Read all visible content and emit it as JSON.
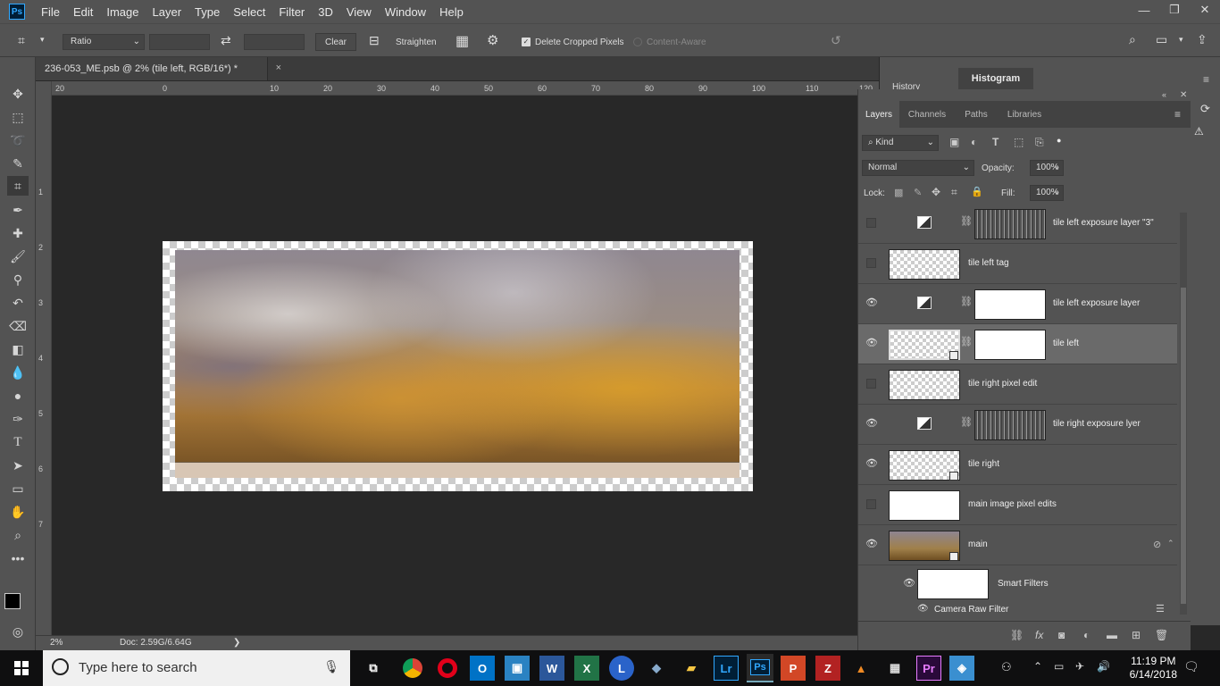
{
  "app": {
    "logo": "Ps",
    "menu": [
      "File",
      "Edit",
      "Image",
      "Layer",
      "Type",
      "Select",
      "Filter",
      "3D",
      "View",
      "Window",
      "Help"
    ]
  },
  "window_controls": {
    "minimize": "—",
    "restore": "❐",
    "close": "✕"
  },
  "options_bar": {
    "ratio": "Ratio",
    "clear": "Clear",
    "straighten": "Straighten",
    "delete_cropped": "Delete Cropped Pixels",
    "content_aware": "Content-Aware"
  },
  "document": {
    "tab_title": "236-053_ME.psb @ 2% (tile left, RGB/16*) *",
    "close": "×"
  },
  "ruler": {
    "h_ticks": [
      "20",
      "0",
      "10",
      "20",
      "30",
      "40",
      "50",
      "60",
      "70",
      "80",
      "90",
      "100",
      "110",
      "120"
    ],
    "v_ticks": [
      "1",
      "2",
      "3",
      "4",
      "5",
      "6",
      "7"
    ]
  },
  "status": {
    "zoom": "2%",
    "doc": "Doc: 2.59G/6.64G",
    "arrow": "❯"
  },
  "collapsed_panels": {
    "history": "History",
    "histogram": "Histogram"
  },
  "layers_panel": {
    "tabs": [
      "Layers",
      "Channels",
      "Paths",
      "Libraries"
    ],
    "filter_kind": "Kind",
    "blend_mode": "Normal",
    "opacity_label": "Opacity:",
    "opacity": "100%",
    "lock_label": "Lock:",
    "fill_label": "Fill:",
    "fill": "100%",
    "layers": [
      {
        "name": "tile left exposure layer \"3\"",
        "visible": false,
        "type": "adjustment",
        "mask": "noise"
      },
      {
        "name": "tile left tag",
        "visible": false,
        "type": "pixel"
      },
      {
        "name": "tile left exposure layer",
        "visible": true,
        "type": "adjustment",
        "mask": "white"
      },
      {
        "name": "tile left",
        "visible": true,
        "type": "smart",
        "mask": "white",
        "selected": true
      },
      {
        "name": "tile right pixel edit",
        "visible": false,
        "type": "pixel"
      },
      {
        "name": "tile right exposure lyer",
        "visible": true,
        "type": "adjustment",
        "mask": "noise"
      },
      {
        "name": "tile right",
        "visible": true,
        "type": "smart"
      },
      {
        "name": "main image pixel edits",
        "visible": false,
        "type": "pixel"
      },
      {
        "name": "main",
        "visible": true,
        "type": "smart-photo"
      }
    ],
    "smart_filters": "Smart Filters",
    "camera_raw": "Camera Raw Filter"
  },
  "taskbar": {
    "search_placeholder": "Type here to search",
    "time": "11:19 PM",
    "date": "6/14/2018"
  }
}
